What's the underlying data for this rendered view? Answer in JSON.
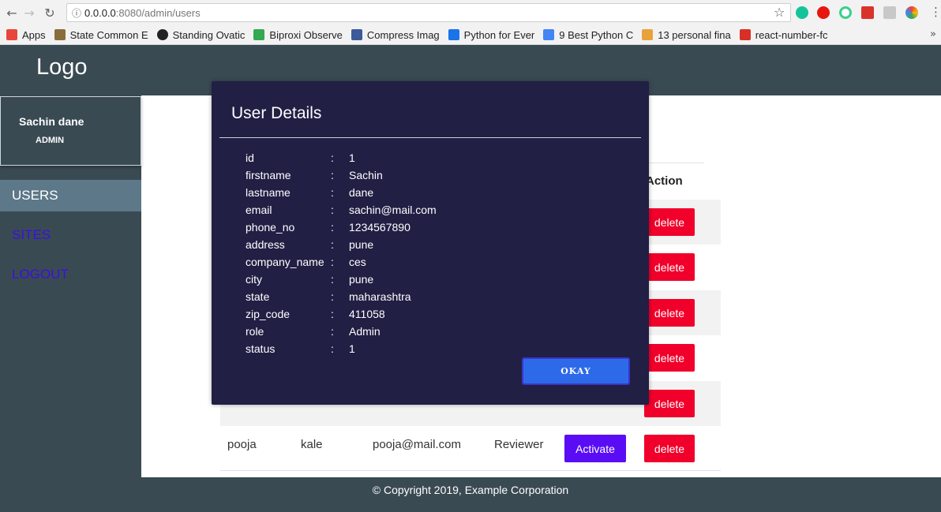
{
  "browser": {
    "url_host": "0.0.0.0",
    "url_port_path": ":8080/admin/users",
    "bookmarks": [
      {
        "label": "Apps",
        "color": "#e8453c"
      },
      {
        "label": "State Common E",
        "color": "#8a6d3b"
      },
      {
        "label": "Standing Ovatic",
        "color": "#222222"
      },
      {
        "label": "Biproxi Observe",
        "color": "#34a853"
      },
      {
        "label": "Compress Imag",
        "color": "#3c5a99"
      },
      {
        "label": "Python for Ever",
        "color": "#1a73e8"
      },
      {
        "label": "9 Best Python C",
        "color": "#4285f4"
      },
      {
        "label": "13 personal fina",
        "color": "#e8a23c"
      },
      {
        "label": "react-number-fc",
        "color": "#d93025"
      }
    ],
    "more": "»"
  },
  "app": {
    "logo": "Logo",
    "profile": {
      "name": "Sachin dane",
      "role": "ADMIN"
    },
    "nav": {
      "users": "USERS",
      "sites": "SITES",
      "logout": "LOGOUT"
    },
    "table": {
      "action_header": "Action",
      "delete_label": "delete",
      "activate_label": "Activate",
      "last_row": {
        "firstname": "pooja",
        "lastname": "kale",
        "email": "pooja@mail.com",
        "role": "Reviewer"
      }
    },
    "footer": "© Copyright 2019, Example Corporation"
  },
  "modal": {
    "title": "User Details",
    "fields": [
      {
        "key": "id",
        "value": "1"
      },
      {
        "key": "firstname",
        "value": "Sachin"
      },
      {
        "key": "lastname",
        "value": "dane"
      },
      {
        "key": "email",
        "value": "sachin@mail.com"
      },
      {
        "key": "phone_no",
        "value": "1234567890"
      },
      {
        "key": "address",
        "value": "pune"
      },
      {
        "key": "company_name",
        "value": "ces"
      },
      {
        "key": "city",
        "value": "pune"
      },
      {
        "key": "state",
        "value": "maharashtra"
      },
      {
        "key": "zip_code",
        "value": "411058"
      },
      {
        "key": "role",
        "value": "Admin"
      },
      {
        "key": "status",
        "value": "1"
      }
    ],
    "okay_label": "OKAY"
  },
  "colors": {
    "accent": "#2d6ae9",
    "danger": "#f0002a",
    "activate": "#5a0df5",
    "sidebar": "#3a4a53"
  }
}
